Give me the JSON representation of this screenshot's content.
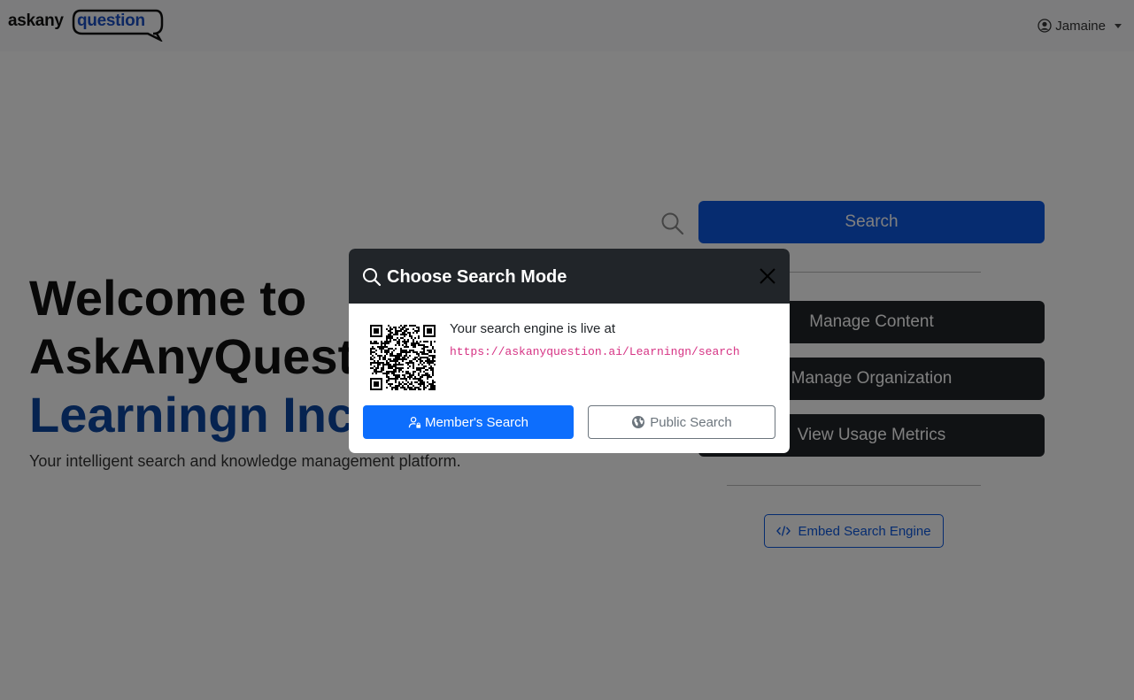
{
  "navbar": {
    "brand_prefix": "askany",
    "brand_suffix": "question",
    "user_name": "Jamaine"
  },
  "hero": {
    "title_line1": "Welcome to",
    "title_line2": "AskAnyQuestion,",
    "org_name": "Learningn Inc.",
    "subtitle": "Your intelligent search and knowledge management platform."
  },
  "actions": {
    "search_label": "Search",
    "manage_content_label": "Manage Content",
    "manage_org_label": "Manage Organization",
    "usage_metrics_label": "View Usage Metrics",
    "embed_label": "Embed Search Engine"
  },
  "modal": {
    "title": "Choose Search Mode",
    "live_text": "Your search engine is live at",
    "url": "https://askanyquestion.ai/Learningn/search",
    "member_button": "Member's Search",
    "public_button": "Public Search"
  },
  "colors": {
    "primary": "#0d6efd",
    "dark": "#212529",
    "brand_blue": "#0d47a1",
    "url_pink": "#d63384"
  }
}
